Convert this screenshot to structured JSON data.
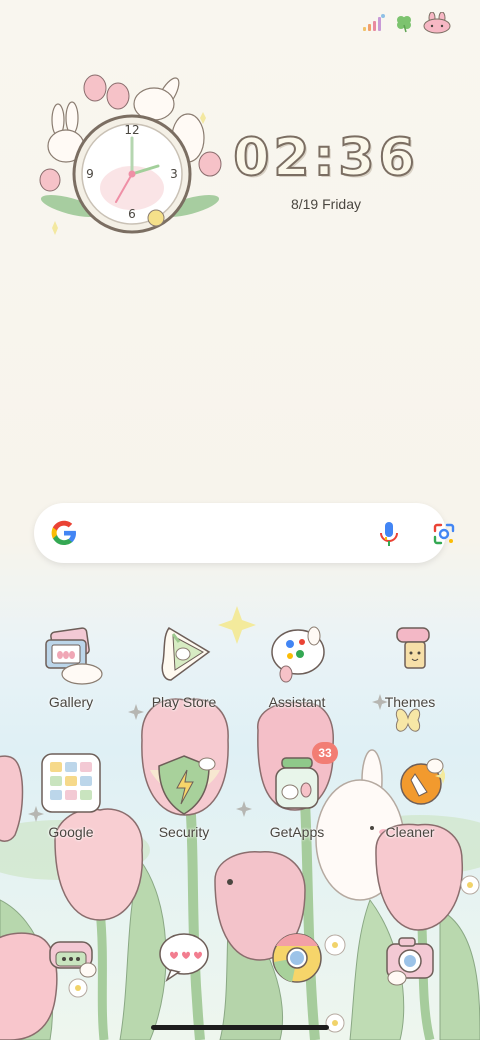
{
  "status_bar": {
    "icons": [
      "signal-icon",
      "clover-icon",
      "bunny-face-icon"
    ]
  },
  "clock_widget": {
    "numerals": {
      "twelve": "12",
      "three": "3",
      "six": "6",
      "nine": "9"
    }
  },
  "time_widget": {
    "time": "02:36",
    "date": "8/19 Friday"
  },
  "search_bar": {
    "icons": [
      "google-g-icon",
      "mic-icon",
      "lens-icon"
    ]
  },
  "apps_row1": [
    {
      "label": "Gallery"
    },
    {
      "label": "Play Store"
    },
    {
      "label": "Assistant"
    },
    {
      "label": "Themes"
    }
  ],
  "apps_row2": [
    {
      "label": "Google"
    },
    {
      "label": "Security"
    },
    {
      "label": "GetApps",
      "badge": "33"
    },
    {
      "label": "Cleaner"
    }
  ],
  "dock": [
    {
      "icon": "phone-icon"
    },
    {
      "icon": "messages-icon"
    },
    {
      "icon": "chrome-icon"
    },
    {
      "icon": "camera-icon"
    }
  ],
  "colors": {
    "tulip_pink": "#f6c8cc",
    "leaf_green": "#b9d7ad",
    "badge_red": "#f27d74",
    "text_dark": "#4a4640"
  }
}
